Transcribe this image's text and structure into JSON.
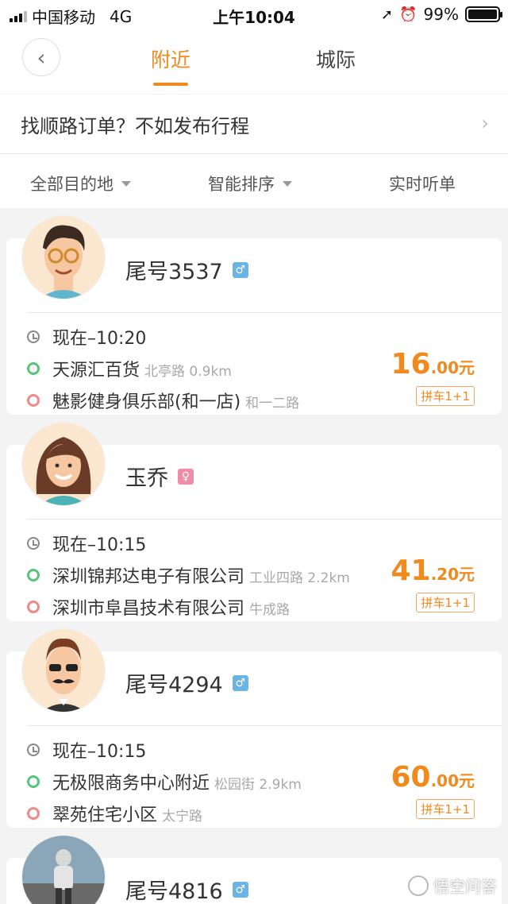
{
  "status_bar": {
    "carrier": "中国移动",
    "network": "4G",
    "time": "上午10:04",
    "battery": "99%",
    "battery_level": 0.99
  },
  "nav": {
    "back_icon": "chevron-left-icon",
    "tabs": [
      {
        "label": "附近",
        "active": true
      },
      {
        "label": "城际",
        "active": false
      }
    ]
  },
  "banner": {
    "text": "找顺路订单？不如发布行程",
    "arrow": "›"
  },
  "filters": [
    {
      "label": "全部目的地",
      "dropdown": true
    },
    {
      "label": "智能排序",
      "dropdown": true
    },
    {
      "label": "实时听单",
      "dropdown": false
    }
  ],
  "colors": {
    "accent": "#f08a1d",
    "start_dot": "#5cc37a",
    "end_dot": "#ee8a8a",
    "male": "#6cb4e4",
    "female": "#f08ca8"
  },
  "orders": [
    {
      "name": "尾号3537",
      "gender": "male",
      "gender_icon": "male-icon",
      "avatar": "cartoon-man-glasses",
      "time": "现在–10:20",
      "from": "天源汇百货",
      "from_sub": "北亭路 0.9km",
      "to": "魅影健身俱乐部(和一店)",
      "to_sub": "和一二路",
      "price_int": "16",
      "price_dec": ".00元",
      "tag": "拼车1+1"
    },
    {
      "name": "玉乔",
      "gender": "female",
      "gender_icon": "female-icon",
      "avatar": "cartoon-woman",
      "time": "现在–10:15",
      "from": "深圳锦邦达电子有限公司",
      "from_sub": "工业四路 2.2km",
      "to": "深圳市阜昌技术有限公司",
      "to_sub": "牛成路",
      "price_int": "41",
      "price_dec": ".20元",
      "tag": "拼车1+1"
    },
    {
      "name": "尾号4294",
      "gender": "male",
      "gender_icon": "male-icon",
      "avatar": "cartoon-man-mustache",
      "time": "现在–10:15",
      "from": "无极限商务中心附近",
      "from_sub": "松园街 2.9km",
      "to": "翠苑住宅小区",
      "to_sub": "太宁路",
      "price_int": "60",
      "price_dec": ".00元",
      "tag": "拼车1+1"
    },
    {
      "name": "尾号4816",
      "gender": "male",
      "gender_icon": "male-icon",
      "avatar": "photo-runner"
    }
  ],
  "watermark": "悟空问答"
}
